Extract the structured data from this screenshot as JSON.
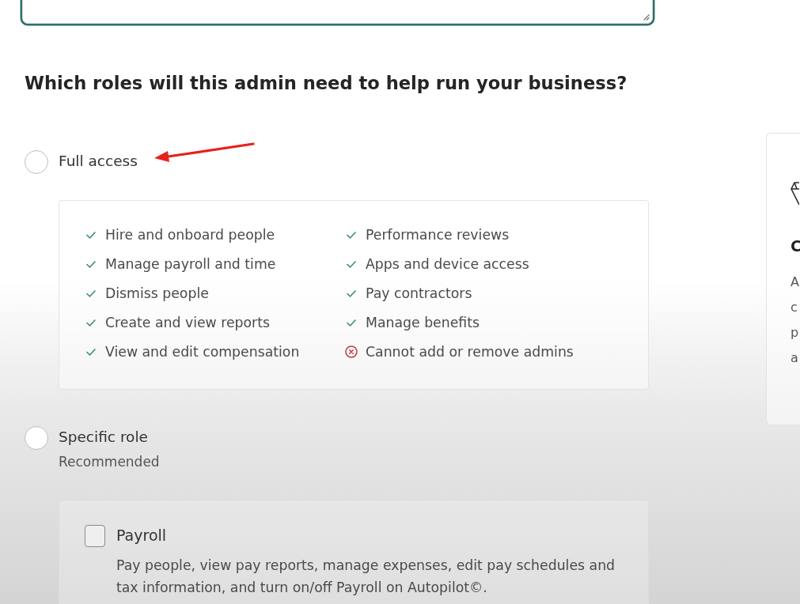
{
  "notes_field": {
    "focused": true
  },
  "question": "Which roles will this admin need to help run your business?",
  "role_options": [
    {
      "kind": "permissions",
      "label": "Full access",
      "selected": false,
      "annotated": true,
      "permissions": [
        {
          "label": "Hire and onboard people",
          "allowed": true
        },
        {
          "label": "Manage payroll and time",
          "allowed": true
        },
        {
          "label": "Dismiss people",
          "allowed": true
        },
        {
          "label": "Create and view reports",
          "allowed": true
        },
        {
          "label": "View and edit compensation",
          "allowed": true
        },
        {
          "label": "Performance reviews",
          "allowed": true
        },
        {
          "label": "Apps and device access",
          "allowed": true
        },
        {
          "label": "Pay contractors",
          "allowed": true
        },
        {
          "label": "Manage benefits",
          "allowed": true
        },
        {
          "label": "Cannot add or remove admins",
          "allowed": false
        }
      ]
    },
    {
      "kind": "roles",
      "label": "Specific role",
      "sublabel": "Recommended",
      "selected": false,
      "annotated": false,
      "roles": [
        {
          "label": "Payroll",
          "description": "Pay people, view pay reports, manage expenses, edit pay schedules and tax information, and turn on/off Payroll on Autopilot©.",
          "checked": false
        }
      ]
    }
  ],
  "side_card": {
    "title": "C",
    "lines": [
      "A",
      "c",
      "p",
      "a"
    ]
  }
}
